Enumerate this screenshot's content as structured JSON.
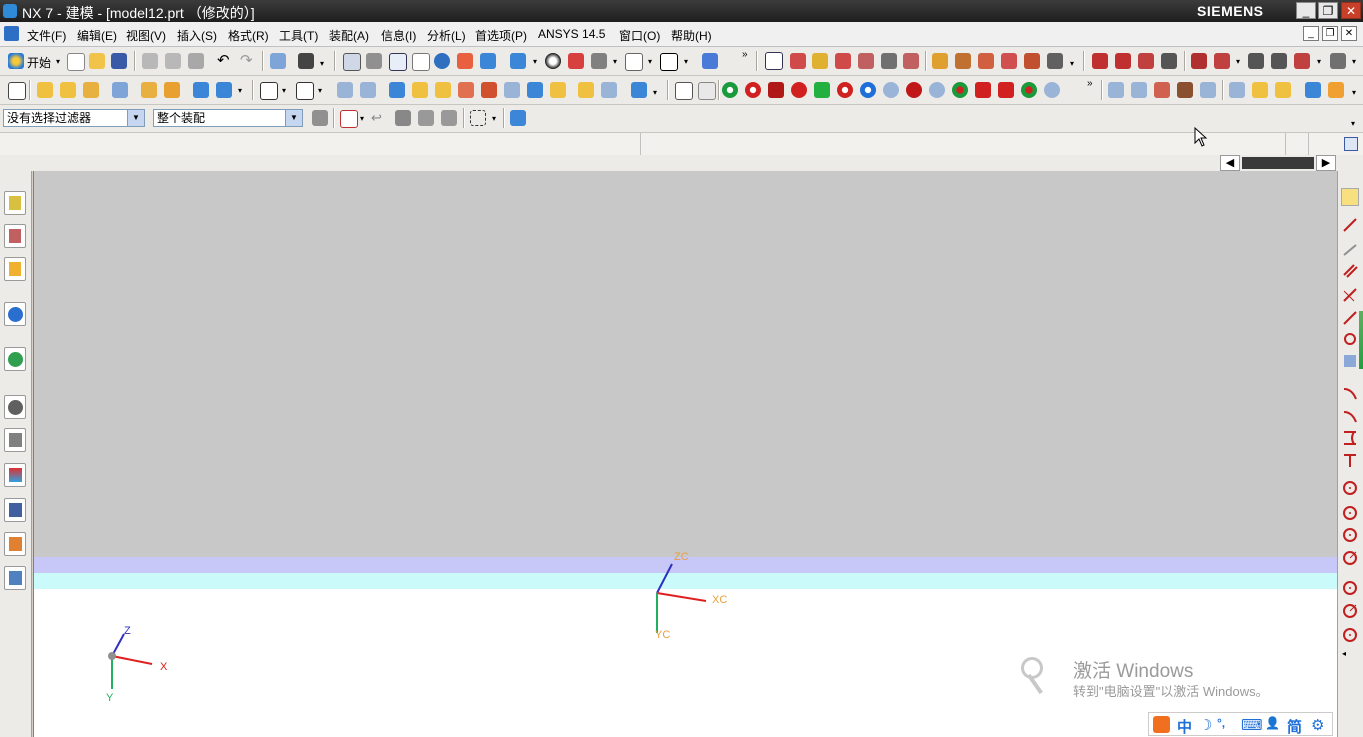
{
  "window": {
    "title": "NX 7 - 建模 - [model12.prt （修改的）]",
    "brand": "SIEMENS",
    "minimize": "_",
    "restore": "❐",
    "close": "✕"
  },
  "menu": {
    "items": [
      "文件(F)",
      "编辑(E)",
      "视图(V)",
      "插入(S)",
      "格式(R)",
      "工具(T)",
      "装配(A)",
      "信息(I)",
      "分析(L)",
      "首选项(P)",
      "ANSYS 14.5",
      "窗口(O)",
      "帮助(H)"
    ]
  },
  "toolbar": {
    "start_label": "开始",
    "filter_value": "没有选择过滤器",
    "scope_value": "整个装配"
  },
  "graphics": {
    "wcs": {
      "x": "XC",
      "y": "YC",
      "z": "ZC"
    },
    "abs": {
      "x": "X",
      "y": "Y",
      "z": "Z"
    }
  },
  "watermark": {
    "title": "激活 Windows",
    "subtitle": "转到\"电脑设置\"以激活 Windows。"
  },
  "ime": {
    "items": [
      "中",
      "☽",
      "°,",
      "⌨",
      "👤",
      "简",
      "⚙"
    ]
  },
  "colors": {
    "sky_band": "#c8c8f8",
    "cyan_band": "#cbfafa",
    "x_axis": "#e02020",
    "y_axis": "#20b060",
    "z_axis": "#3030c0"
  }
}
